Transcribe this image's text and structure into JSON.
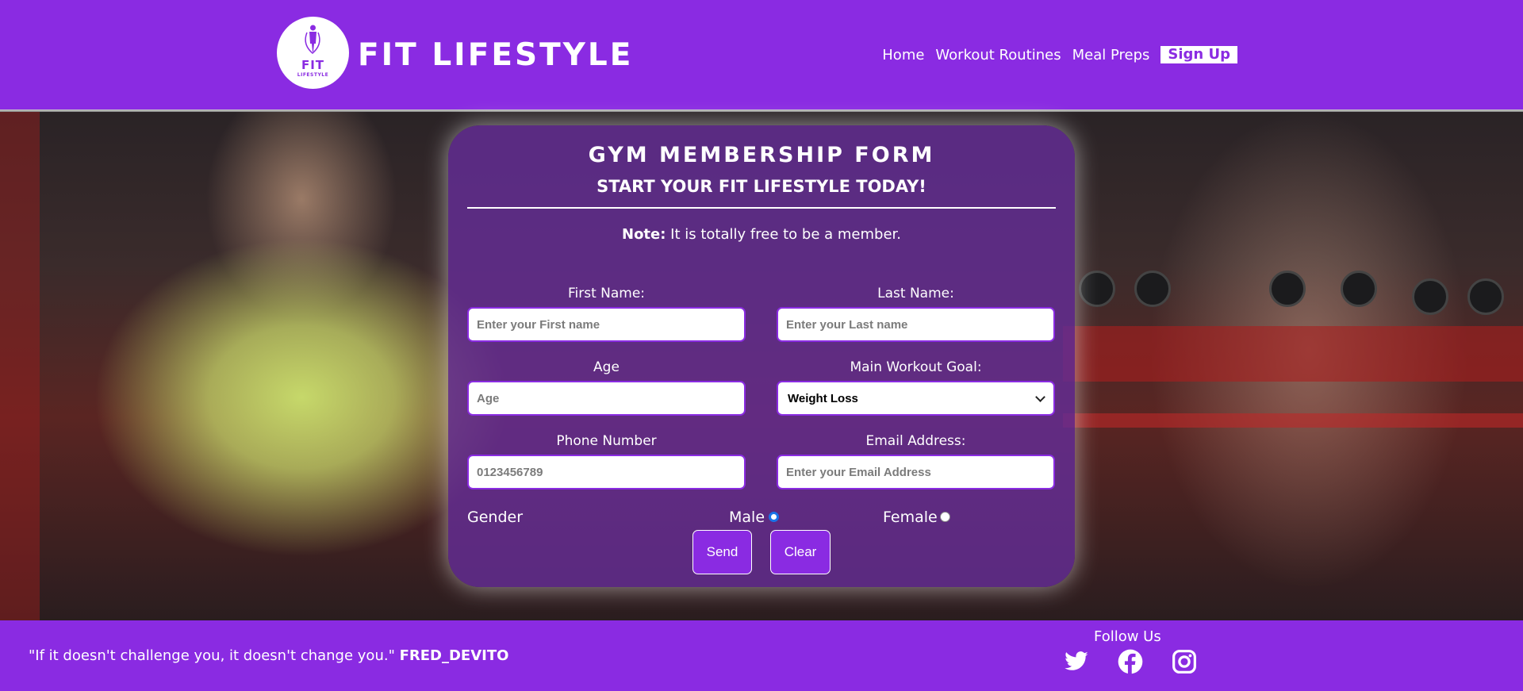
{
  "header": {
    "logo_text": "FIT",
    "logo_subtext": "LIFESTYLE",
    "brand": "FIT LIFESTYLE",
    "nav": [
      "Home",
      "Workout Routines",
      "Meal Preps"
    ],
    "signup": "Sign Up"
  },
  "form": {
    "title": "GYM MEMBERSHIP FORM",
    "subtitle": "START YOUR FIT LIFESTYLE TODAY!",
    "note_label": "Note:",
    "note_text": " It is totally free to be a member.",
    "first_name_label": "First Name:",
    "first_name_placeholder": "Enter your First name",
    "last_name_label": "Last Name:",
    "last_name_placeholder": "Enter your Last name",
    "age_label": "Age",
    "age_placeholder": "Age",
    "goal_label": "Main Workout Goal:",
    "goal_selected": "Weight Loss",
    "phone_label": "Phone Number",
    "phone_placeholder": "0123456789",
    "email_label": "Email Address:",
    "email_placeholder": "Enter your Email Address",
    "gender_label": "Gender",
    "gender_male": "Male",
    "gender_female": "Female",
    "gender_selected": "Male",
    "send_label": "Send",
    "clear_label": "Clear"
  },
  "footer": {
    "quote": "\"If it doesn't challenge you, it doesn't change you.\"",
    "author": "FRED_DEVITO",
    "follow": "Follow Us",
    "social_icons": [
      "twitter-icon",
      "facebook-icon",
      "instagram-icon"
    ]
  },
  "colors": {
    "accent": "#8a2be2",
    "panel": "#642d96",
    "text": "#ffffff",
    "radio_selected": "#1a73e8"
  }
}
